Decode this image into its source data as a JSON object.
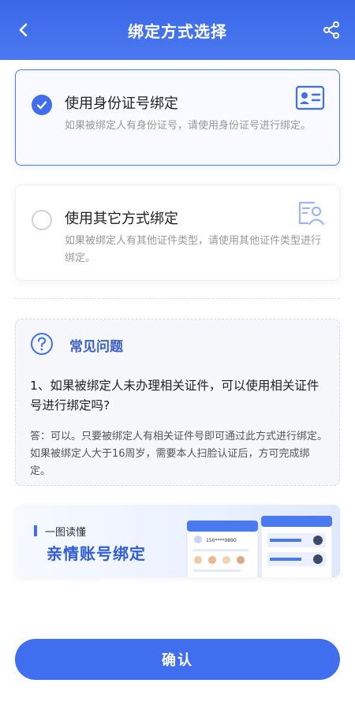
{
  "header": {
    "title": "绑定方式选择"
  },
  "options": [
    {
      "title": "使用身份证号绑定",
      "description": "如果被绑定人有身份证号，请使用身份证号进行绑定。",
      "selected": true
    },
    {
      "title": "使用其它方式绑定",
      "description": "如果被绑定人有其他证件类型，请使用其他证件类型进行绑定。",
      "selected": false
    }
  ],
  "faq": {
    "heading": "常见问题",
    "question": "1、如果被绑定人未办理相关证件，可以使用相关证件号进行绑定吗?",
    "answer": "答：可以。只要被绑定人有相关证件号即可通过此方式进行绑定。如果被绑定人大于16周岁，需要本人扫脸认证后，方可完成绑定。"
  },
  "banner": {
    "subtitle": "一图读懂",
    "title": "亲情账号绑定",
    "preview_phone": "150****0890"
  },
  "confirm_label": "确认",
  "colors": {
    "primary": "#3f6fee",
    "header_bg": "#4a79f0",
    "faq_heading": "#3a5fc8"
  }
}
